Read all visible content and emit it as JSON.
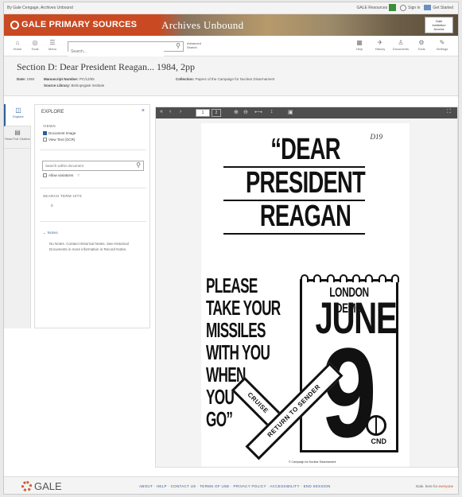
{
  "topbar": {
    "left": "By Gale Cengage, Archives Unbound",
    "items": [
      "GALE Resources",
      "Sign in",
      "Get Started"
    ]
  },
  "banner": {
    "brand": "GALE PRIMARY SOURCES",
    "product": "Archives Unbound",
    "institution_lines": [
      "Gale",
      "Institution",
      "Access"
    ]
  },
  "toolbar": {
    "left_tools": [
      {
        "icon": "home-icon",
        "label": "Home"
      },
      {
        "icon": "browse-icon",
        "label": "Tools"
      },
      {
        "icon": "menu-icon",
        "label": "Menu"
      }
    ],
    "search_placeholder": "Search...",
    "advanced_label": "Advanced Search",
    "right_tools": [
      {
        "icon": "help-icon",
        "label": "Help"
      },
      {
        "icon": "history-icon",
        "label": "History"
      },
      {
        "icon": "documents-icon",
        "label": "Documents"
      },
      {
        "icon": "tools-icon",
        "label": "Tools"
      },
      {
        "icon": "settings-icon",
        "label": "Settings"
      }
    ]
  },
  "document": {
    "title": "Section D: Dear President Reagan... 1984, 2pp",
    "date_label": "Date:",
    "date": "1984",
    "manuscript_label": "Manuscript Number:",
    "manuscript": "PC/12/55",
    "source_label": "Source Library:",
    "source": "Bishopsgate Institute",
    "collection_label": "Collection:",
    "collection": "Papers of the Campaign for Nuclear Disarmament"
  },
  "rail": {
    "tabs": [
      {
        "icon": "explore-icon",
        "label": "Explore"
      },
      {
        "icon": "fulltext-icon",
        "label": "Read Full Citation"
      }
    ]
  },
  "explore": {
    "title": "EXPLORE",
    "close": "×",
    "views_label": "VIEWS",
    "view_options": [
      {
        "label": "Document Image",
        "checked": true
      },
      {
        "label": "View Text (OCR)",
        "checked": false
      }
    ],
    "within_placeholder": "Search within document",
    "variations_label": "Allow variations",
    "hits_label": "SEARCH TERM HITS",
    "hits_value": "0",
    "notes_label": "Notes",
    "notes_text": "No Notes. Contact Historical Notes. See Historical Documents in more information in Record Notes."
  },
  "viewer": {
    "page_current": "1",
    "page_total": "2"
  },
  "poster": {
    "line1": "“DEAR",
    "line2": "PRESIDENT",
    "line3": "REAGAN",
    "handwritten": "D19",
    "left_lines": [
      "PLEASE",
      "TAKE YOUR",
      "MISSILES",
      "WITH YOU",
      "WHEN",
      "YOU",
      "GO”"
    ],
    "demo": "LONDON DEMO",
    "month": "JUNE",
    "day": "9",
    "cnd": "CND",
    "cross_a": "RETURN TO SENDER",
    "cross_b": "CRUISE",
    "footnote": "© Campaign for Nuclear Disarmament"
  },
  "footer": {
    "logo": "GALE",
    "links": "ABOUT · HELP · CONTACT US · TERMS OF USE · PRIVACY POLICY · ACCESSIBILITY · END SESSION",
    "right_prefix": "Gale, here for",
    "right_highlight": "everyone"
  }
}
